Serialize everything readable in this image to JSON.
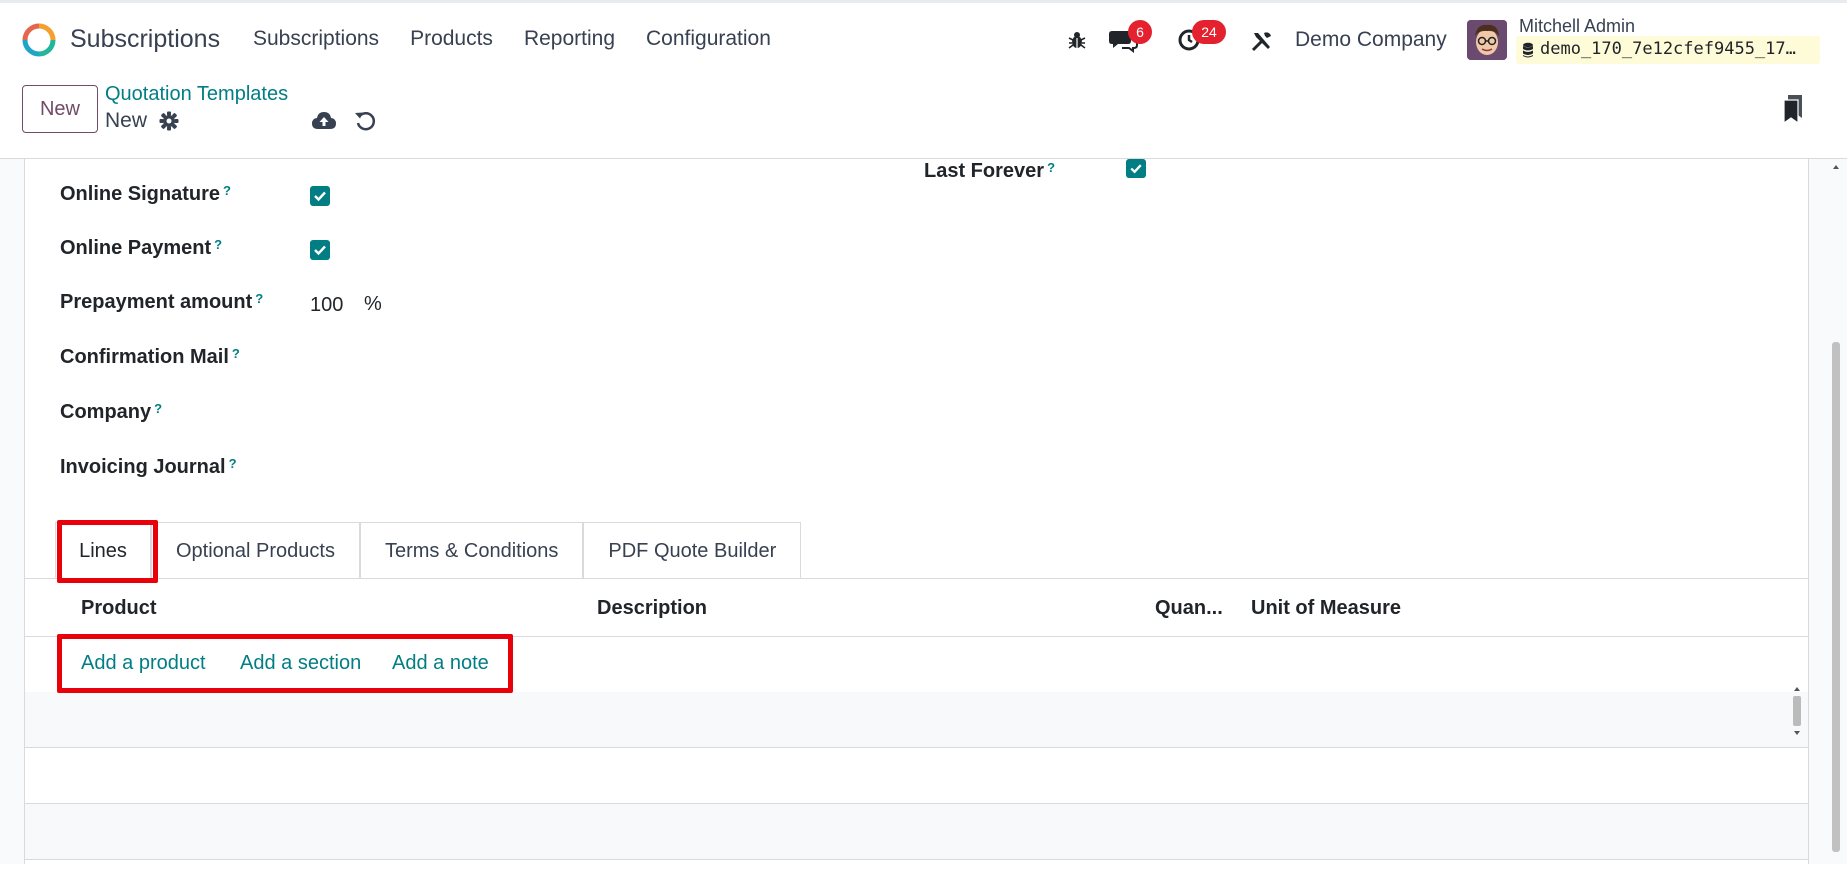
{
  "topbar": {
    "app_name": "Subscriptions",
    "menu": [
      "Subscriptions",
      "Products",
      "Reporting",
      "Configuration"
    ],
    "messages_count": "6",
    "activities_count": "24",
    "company": "Demo Company",
    "user_name": "Mitchell Admin",
    "database": "demo_170_7e12cfef9455_17…",
    "icons": [
      "bug-icon",
      "chat-icon",
      "clock-icon",
      "tools-icon",
      "database-icon"
    ]
  },
  "control": {
    "new_button": "New",
    "breadcrumb_parent": "Quotation Templates",
    "record_name": "New"
  },
  "form": {
    "online_signature": "Online Signature",
    "online_payment": "Online Payment",
    "prepayment_amount": "Prepayment amount",
    "prepayment_value": "100",
    "prepayment_unit": "%",
    "confirmation_mail": "Confirmation Mail",
    "company": "Company",
    "invoicing_journal": "Invoicing Journal",
    "last_forever": "Last Forever",
    "help_mark": "?"
  },
  "tabs": [
    "Lines",
    "Optional Products",
    "Terms & Conditions",
    "PDF Quote Builder"
  ],
  "lines_table": {
    "columns": [
      "Product",
      "Description",
      "Quan...",
      "Unit of Measure"
    ],
    "add_product": "Add a product",
    "add_section": "Add a section",
    "add_note": "Add a note"
  },
  "colors": {
    "accent_teal": "#017e84",
    "brand_purple": "#714b67",
    "badge_red": "#e4222f",
    "highlight_red": "#e8000b"
  }
}
